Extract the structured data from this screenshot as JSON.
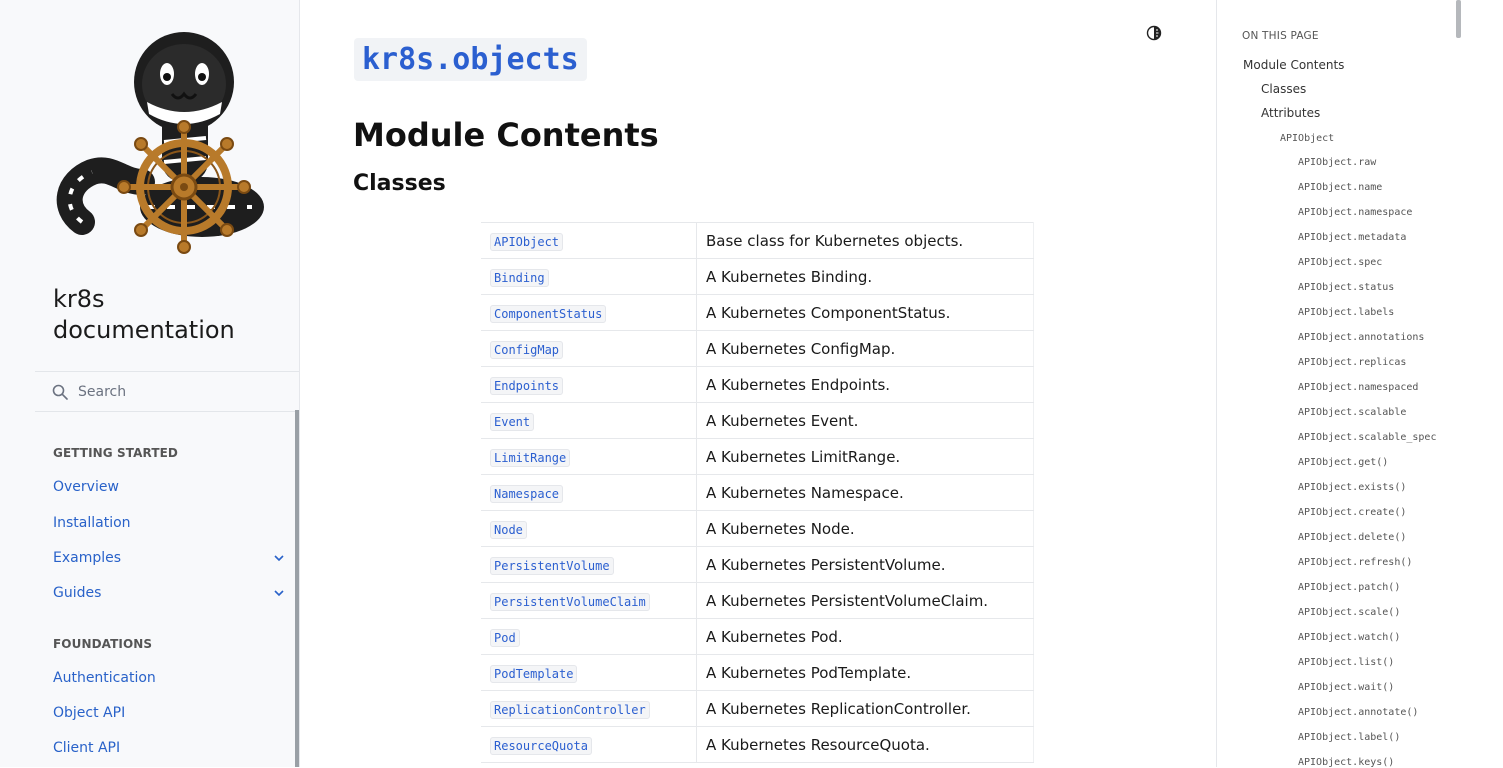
{
  "sidebar": {
    "brand": "kr8s\ndocumentation",
    "search": {
      "placeholder": "Search"
    },
    "sections": [
      {
        "title": "GETTING STARTED",
        "items": [
          {
            "label": "Overview",
            "expandable": false
          },
          {
            "label": "Installation",
            "expandable": false
          },
          {
            "label": "Examples",
            "expandable": true
          },
          {
            "label": "Guides",
            "expandable": true
          }
        ]
      },
      {
        "title": "FOUNDATIONS",
        "items": [
          {
            "label": "Authentication",
            "expandable": false
          },
          {
            "label": "Object API",
            "expandable": false
          },
          {
            "label": "Client API",
            "expandable": false
          }
        ]
      }
    ]
  },
  "main": {
    "module_title": "kr8s.objects",
    "h1": "Module Contents",
    "h2": "Classes",
    "classes": [
      {
        "name": "APIObject",
        "desc": "Base class for Kubernetes objects."
      },
      {
        "name": "Binding",
        "desc": "A Kubernetes Binding."
      },
      {
        "name": "ComponentStatus",
        "desc": "A Kubernetes ComponentStatus."
      },
      {
        "name": "ConfigMap",
        "desc": "A Kubernetes ConfigMap."
      },
      {
        "name": "Endpoints",
        "desc": "A Kubernetes Endpoints."
      },
      {
        "name": "Event",
        "desc": "A Kubernetes Event."
      },
      {
        "name": "LimitRange",
        "desc": "A Kubernetes LimitRange."
      },
      {
        "name": "Namespace",
        "desc": "A Kubernetes Namespace."
      },
      {
        "name": "Node",
        "desc": "A Kubernetes Node."
      },
      {
        "name": "PersistentVolume",
        "desc": "A Kubernetes PersistentVolume."
      },
      {
        "name": "PersistentVolumeClaim",
        "desc": "A Kubernetes PersistentVolumeClaim."
      },
      {
        "name": "Pod",
        "desc": "A Kubernetes Pod."
      },
      {
        "name": "PodTemplate",
        "desc": "A Kubernetes PodTemplate."
      },
      {
        "name": "ReplicationController",
        "desc": "A Kubernetes ReplicationController."
      },
      {
        "name": "ResourceQuota",
        "desc": "A Kubernetes ResourceQuota."
      }
    ]
  },
  "toc": {
    "title": "ON THIS PAGE",
    "module_contents": "Module Contents",
    "classes": "Classes",
    "attributes": "Attributes",
    "apiobject": "APIObject",
    "members": [
      "APIObject.raw",
      "APIObject.name",
      "APIObject.namespace",
      "APIObject.metadata",
      "APIObject.spec",
      "APIObject.status",
      "APIObject.labels",
      "APIObject.annotations",
      "APIObject.replicas",
      "APIObject.namespaced",
      "APIObject.scalable",
      "APIObject.scalable_spec",
      "APIObject.get()",
      "APIObject.exists()",
      "APIObject.create()",
      "APIObject.delete()",
      "APIObject.refresh()",
      "APIObject.patch()",
      "APIObject.scale()",
      "APIObject.watch()",
      "APIObject.list()",
      "APIObject.wait()",
      "APIObject.annotate()",
      "APIObject.label()",
      "APIObject.keys()"
    ]
  },
  "colors": {
    "link": "#2962c9",
    "code_link": "#2b5fd0",
    "sidebar_bg": "#f8f9fb"
  },
  "icons": {
    "search": "search-icon",
    "theme": "theme-toggle-icon",
    "chevron": "chevron-down-icon"
  }
}
